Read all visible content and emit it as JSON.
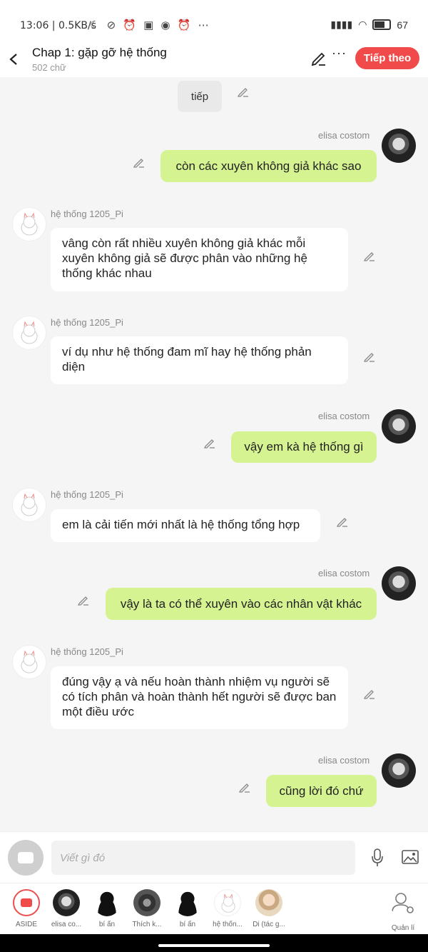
{
  "status_bar": {
    "time": "13:06",
    "speed": "0.5KB/s",
    "icons": [
      "moon-icon",
      "mute-icon",
      "alarm-icon",
      "zalo-icon",
      "messenger-icon",
      "clock-icon",
      "more-icon"
    ],
    "battery": "67"
  },
  "header": {
    "title": "Chap 1: gặp gỡ hệ thống",
    "word_count": "502 chữ",
    "next_label": "Tiếp theo"
  },
  "chat": {
    "chip": "tiếp",
    "messages": [
      {
        "side": "right",
        "author": "elisa costom",
        "text": "còn các xuyên không giả khác sao"
      },
      {
        "side": "left",
        "author": "hệ thống 1205_Pi",
        "text": "vâng còn rất nhiều xuyên không giả khác mỗi xuyên không giả sẽ được phân vào những hệ thống khác nhau"
      },
      {
        "side": "left",
        "author": "hệ thống 1205_Pi",
        "text": "ví dụ như hệ thống đam mĩ hay hệ thống phản diện"
      },
      {
        "side": "right",
        "author": "elisa costom",
        "text": "vậy em kà hệ thống gì"
      },
      {
        "side": "left",
        "author": "hệ thống 1205_Pi",
        "text": "em là cải tiến mới nhất là hệ thống tổng hợp"
      },
      {
        "side": "right",
        "author": "elisa costom",
        "text": "vậy là ta có thể xuyên vào các nhân vật khác"
      },
      {
        "side": "left",
        "author": "hệ thống 1205_Pi",
        "text": "đúng vậy ạ và nếu hoàn thành nhiệm vụ người sẽ có tích phân và hoàn thành hết người sẽ được ban một điều ước"
      },
      {
        "side": "right",
        "author": "elisa costom",
        "text": "cũng lời đó chứ"
      }
    ]
  },
  "input": {
    "placeholder": "Viết gì đó"
  },
  "characters": [
    {
      "label": "ASIDE"
    },
    {
      "label": "elisa co..."
    },
    {
      "label": "bí ẩn"
    },
    {
      "label": "Thích k..."
    },
    {
      "label": "bí ẩn"
    },
    {
      "label": "hệ thốn..."
    },
    {
      "label": "Di (tác g..."
    },
    {
      "label": "Quản lí"
    }
  ],
  "colors": {
    "accent": "#f04a4a",
    "my_bubble": "#d6f391",
    "their_bubble": "#ffffff",
    "background": "#f5f5f5"
  }
}
